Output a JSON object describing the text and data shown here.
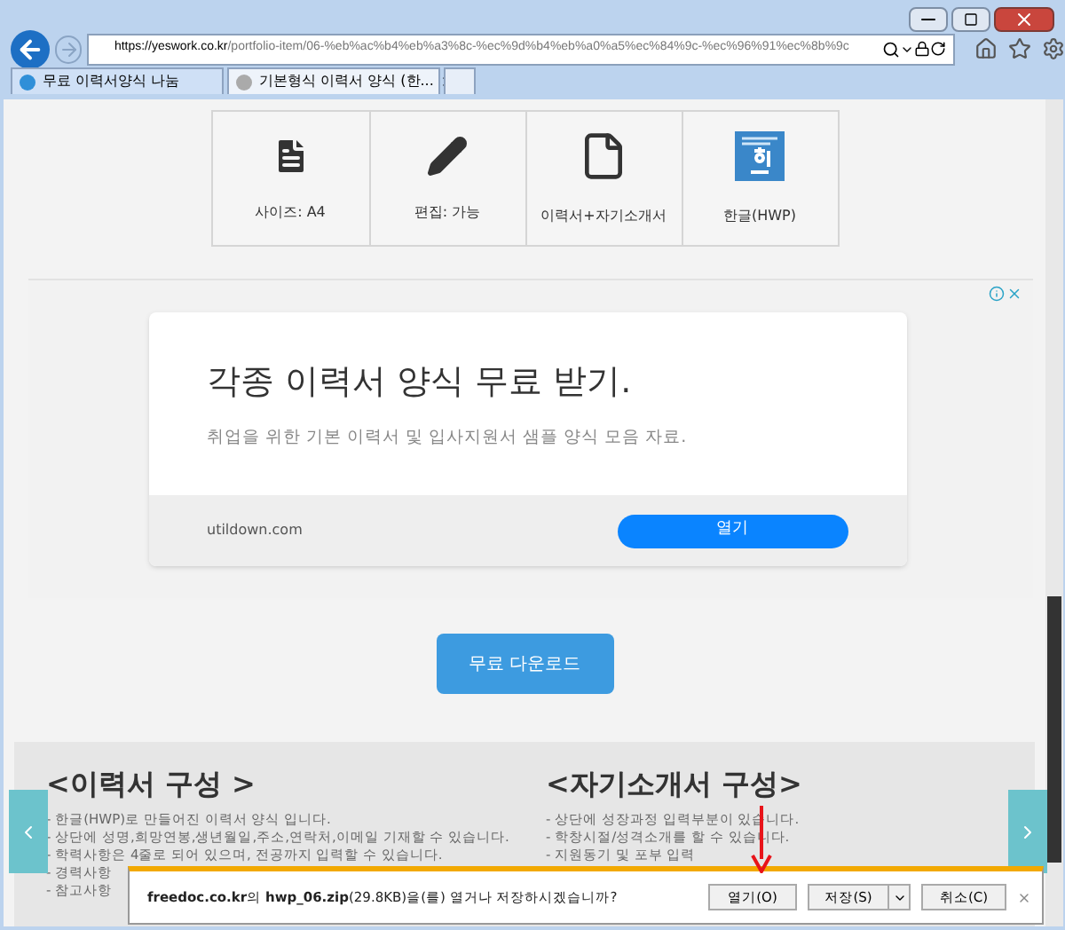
{
  "browser": {
    "url_host": "https://yeswork.co.kr",
    "url_path": "/portfolio-item/06-%eb%ac%b4%eb%a3%8c-%ec%9d%b4%eb%a0%a5%ec%84%9c-%ec%96%91%ec%8b%9c",
    "tabs": [
      {
        "title": "무료 이력서양식 나눔",
        "selected": true,
        "closable": false
      },
      {
        "title": "기본형식 이력서 양식 (한...",
        "selected": false,
        "closable": true
      }
    ]
  },
  "features": [
    {
      "kind": "doc",
      "label": "사이즈: A4"
    },
    {
      "kind": "pencil",
      "label": "편집: 가능"
    },
    {
      "kind": "file",
      "label": "이력서+자기소개서"
    },
    {
      "kind": "hwp",
      "label": "한글(HWP)"
    }
  ],
  "ad": {
    "headline": "각종 이력서 양식 무료 받기.",
    "description": "취업을 위한 기본 이력서 및 입사지원서 샘플 양식 모음 자료.",
    "domain": "utildown.com",
    "button": "열기"
  },
  "download_button": "무료 다운로드",
  "sections": [
    {
      "title": "<이력서 구성 >",
      "lines": [
        "- 한글(HWP)로 만들어진 이력서 양식 입니다.",
        "- 상단에 성명,희망연봉,생년월일,주소,연락처,이메일 기재할 수 있습니다.",
        "- 학력사항은 4줄로 되어 있으며, 전공까지 입력할 수 있습니다.",
        "- 경력사항",
        "- 참고사항"
      ]
    },
    {
      "title": "<자기소개서 구성>",
      "lines": [
        "- 상단에 성장과정 입력부분이 있습니다.",
        "- 학창시절/성격소개를 할 수 있습니다.",
        "- 지원동기 및 포부 입력"
      ]
    }
  ],
  "notification": {
    "site": "freedoc.co.kr",
    "site_suffix": "의",
    "file": "hwp_06.zip",
    "message": "(29.8KB)을(를) 열거나 저장하시겠습니까?",
    "buttons": [
      "열기(O)",
      "저장(S)",
      "취소(C)"
    ]
  }
}
